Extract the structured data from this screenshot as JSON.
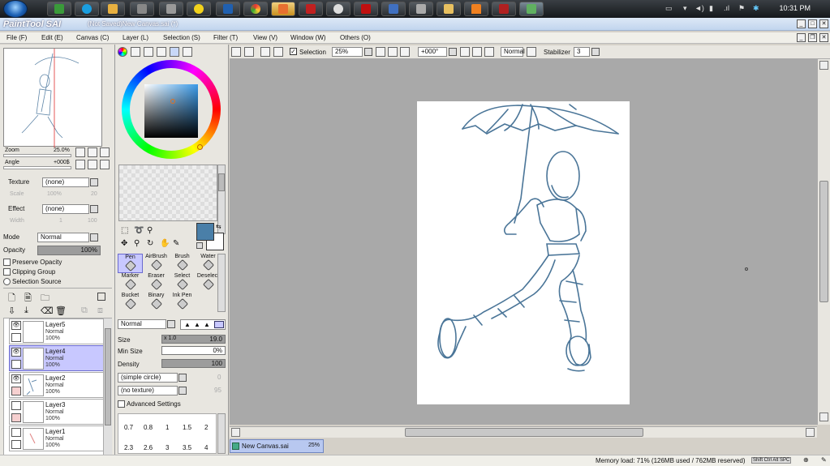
{
  "taskbar": {
    "clock": "10:31 PM"
  },
  "window": {
    "logo": "PaintTool SAI",
    "title": "(Not Saved)New Canvas.sai (*)"
  },
  "menu": [
    "File (F)",
    "Edit (E)",
    "Canvas (C)",
    "Layer (L)",
    "Selection (S)",
    "Filter (T)",
    "View (V)",
    "Window (W)",
    "Others (O)"
  ],
  "navigator": {
    "zoom_label": "Zoom",
    "zoom_value": "25.0%",
    "angle_label": "Angle",
    "angle_value": "+000$"
  },
  "texture": {
    "label": "Texture",
    "value": "(none)",
    "scale_label": "Scale",
    "scale_value": "100%",
    "scale_num": "20"
  },
  "effect": {
    "label": "Effect",
    "value": "(none)",
    "width_label": "Width",
    "width_value": "1",
    "width_num": "100"
  },
  "mode": {
    "label": "Mode",
    "value": "Normal"
  },
  "opacity": {
    "label": "Opacity",
    "value": "100%"
  },
  "checks": {
    "preserve": "Preserve Opacity",
    "clipping": "Clipping Group",
    "selection": "Selection Source"
  },
  "layers": [
    {
      "name": "Layer5",
      "mode": "Normal",
      "opacity": "100%",
      "selected": false
    },
    {
      "name": "Layer4",
      "mode": "Normal",
      "opacity": "100%",
      "selected": true
    },
    {
      "name": "Layer2",
      "mode": "Normal",
      "opacity": "100%",
      "selected": false
    },
    {
      "name": "Layer3",
      "mode": "Normal",
      "opacity": "100%",
      "selected": false
    },
    {
      "name": "Layer1",
      "mode": "Normal",
      "opacity": "100%",
      "selected": false
    }
  ],
  "tools": [
    {
      "label": "Pen"
    },
    {
      "label": "AirBrush"
    },
    {
      "label": "Brush"
    },
    {
      "label": "Water"
    },
    {
      "label": "Marker"
    },
    {
      "label": "Eraser"
    },
    {
      "label": "Select"
    },
    {
      "label": "Deselect"
    },
    {
      "label": "Bucket"
    },
    {
      "label": "Binary"
    },
    {
      "label": "Ink Pen"
    }
  ],
  "brush": {
    "mode": "Normal",
    "size_label": "Size",
    "size_mult": "x 1.0",
    "size_value": "19.0",
    "minsize_label": "Min Size",
    "minsize_value": "0%",
    "density_label": "Density",
    "density_value": "100",
    "shape": "(simple circle)",
    "shape_num": "0",
    "texture": "(no texture)",
    "texture_num": "95",
    "advanced": "Advanced Settings",
    "presets_row1": [
      "0.7",
      "0.8",
      "1",
      "1.5",
      "2"
    ],
    "presets_row2": [
      "2.3",
      "2.6",
      "3",
      "3.5",
      "4"
    ]
  },
  "toolbar": {
    "selection": "Selection",
    "zoom": "25%",
    "angle": "+000°",
    "blend": "Normal",
    "stabilizer_label": "Stabilizer",
    "stabilizer_value": "3"
  },
  "doc_tab": {
    "name": "New Canvas.sai",
    "zoom": "25%"
  },
  "status": {
    "memory": "Memory load: 71% (126MB used / 762MB reserved)",
    "keys": "Shift Ctrl Alt SPC"
  },
  "colors": {
    "stroke": "#4a7598",
    "selected_layer": "#c8c8ff",
    "accent": "#4a7fa8"
  }
}
